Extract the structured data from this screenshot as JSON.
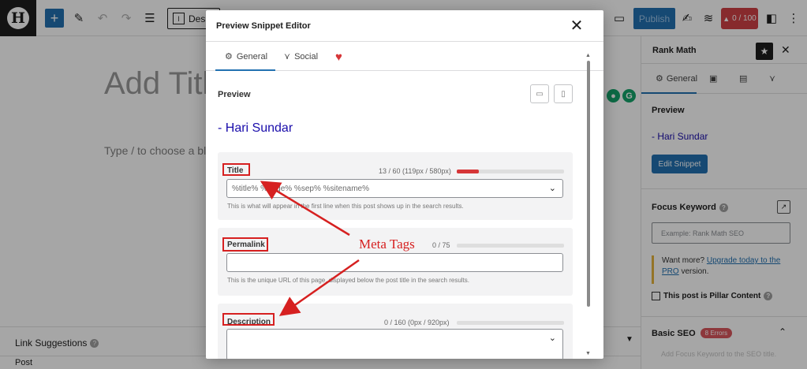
{
  "toolbar": {
    "logo_letter": "H",
    "add_icon": "+",
    "design_label": "Desig",
    "publish_label": "Publish",
    "score_label": "0 / 100"
  },
  "editor": {
    "title_placeholder": "Add Titl",
    "block_placeholder": "Type / to choose a bl",
    "link_suggestions": "Link Suggestions",
    "breadcrumb": "Post"
  },
  "sidebar": {
    "title": "Rank Math",
    "tab_general": "General",
    "preview_label": "Preview",
    "snippet_title": "- Hari Sundar",
    "edit_snippet": "Edit Snippet",
    "focus_keyword_label": "Focus Keyword",
    "focus_keyword_placeholder": "Example: Rank Math SEO",
    "want_more": "Want more?",
    "upgrade_link": "Upgrade today to the PRO",
    "version_suffix": "version.",
    "pillar_label": "This post is Pillar Content",
    "basic_seo": "Basic SEO",
    "errors_badge": "8 Errors",
    "faded_text": "Add Focus Keyword to the SEO title."
  },
  "modal": {
    "title": "Preview Snippet Editor",
    "tabs": [
      "General",
      "Social"
    ],
    "preview_label": "Preview",
    "preview_title": "- Hari Sundar",
    "fields": {
      "title": {
        "label": "Title",
        "count": "13 / 60 (119px / 580px)",
        "progress": 0.205,
        "value": "%title% %page% %sep% %sitename%",
        "help": "This is what will appear in the first line when this post shows up in the search results."
      },
      "permalink": {
        "label": "Permalink",
        "count": "0 / 75",
        "progress": 0,
        "value": "",
        "help": "This is the unique URL of this page, displayed below the post title in the search results."
      },
      "description": {
        "label": "Description",
        "count": "0 / 160 (0px / 920px)",
        "progress": 0,
        "value": ""
      }
    }
  },
  "annotation": {
    "label": "Meta Tags",
    "color": "#d62020"
  }
}
